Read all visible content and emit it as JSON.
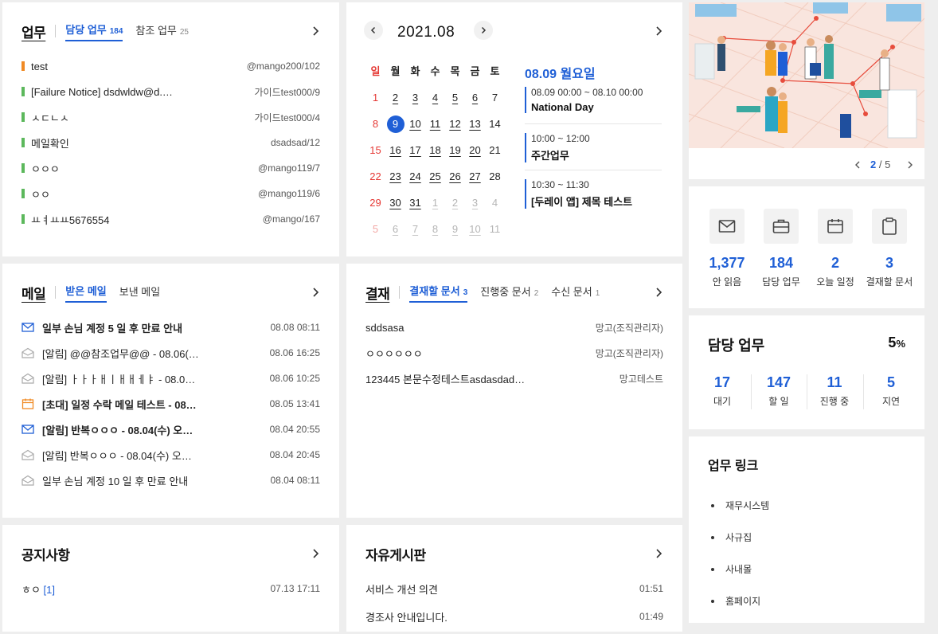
{
  "tasks": {
    "title": "업무",
    "tabs": [
      {
        "label": "담당 업무",
        "count": "184"
      },
      {
        "label": "참조 업무",
        "count": "25"
      }
    ],
    "items": [
      {
        "title": "test",
        "meta": "@mango200/102",
        "color": "#f08a24"
      },
      {
        "title": "[Failure Notice] dsdwldw@d.…",
        "meta": "가이드test000/9",
        "color": "#5cb85c"
      },
      {
        "title": "ㅅㄷㄴㅅ",
        "meta": "가이드test000/4",
        "color": "#5cb85c"
      },
      {
        "title": "메일확인",
        "meta": "dsadsad/12",
        "color": "#5cb85c"
      },
      {
        "title": "ㅇㅇㅇ",
        "meta": "@mango119/7",
        "color": "#5cb85c"
      },
      {
        "title": "ㅇㅇ",
        "meta": "@mango119/6",
        "color": "#5cb85c"
      },
      {
        "title": "ㅛㅕㅛㅛ5676554",
        "meta": "@mango/167",
        "color": "#5cb85c"
      }
    ]
  },
  "calendar": {
    "month": "2021.08",
    "weekdays": [
      "일",
      "월",
      "화",
      "수",
      "목",
      "금",
      "토"
    ],
    "weeks": [
      [
        "1",
        "2",
        "3",
        "4",
        "5",
        "6",
        "7"
      ],
      [
        "8",
        "9",
        "10",
        "11",
        "12",
        "13",
        "14"
      ],
      [
        "15",
        "16",
        "17",
        "18",
        "19",
        "20",
        "21"
      ],
      [
        "22",
        "23",
        "24",
        "25",
        "26",
        "27",
        "28"
      ],
      [
        "29",
        "30",
        "31",
        "1",
        "2",
        "3",
        "4"
      ],
      [
        "5",
        "6",
        "7",
        "8",
        "9",
        "10",
        "11"
      ]
    ],
    "selected_day": "08.09 월요일",
    "events": [
      {
        "time": "08.09 00:00 ~ 08.10 00:00",
        "name": "National Day"
      },
      {
        "time": "10:00 ~ 12:00",
        "name": "주간업무"
      },
      {
        "time": "10:30 ~ 11:30",
        "name": "[두레이 앱] 제목 테스트"
      }
    ]
  },
  "banner": {
    "page": "2",
    "total": "5"
  },
  "stats": [
    {
      "icon": "envelope-icon",
      "value": "1,377",
      "label": "안 읽음"
    },
    {
      "icon": "briefcase-icon",
      "value": "184",
      "label": "담당 업무"
    },
    {
      "icon": "calendar-icon",
      "value": "2",
      "label": "오늘 일정"
    },
    {
      "icon": "clipboard-icon",
      "value": "3",
      "label": "결재할 문서"
    }
  ],
  "my_tasks": {
    "title": "담당 업무",
    "percent": "5",
    "percent_unit": "%",
    "cells": [
      {
        "value": "17",
        "label": "대기"
      },
      {
        "value": "147",
        "label": "할 일"
      },
      {
        "value": "11",
        "label": "진행 중"
      },
      {
        "value": "5",
        "label": "지연"
      }
    ]
  },
  "mail": {
    "title": "메일",
    "tabs": [
      "받은 메일",
      "보낸 메일"
    ],
    "items": [
      {
        "subject": "일부 손님 계정 5 일 후 만료 안내",
        "date": "08.08 08:11",
        "unread": true,
        "icon": "mail-unread-icon"
      },
      {
        "subject": "[알림] @@참조업무@@ - 08.06(…",
        "date": "08.06 16:25",
        "unread": false,
        "icon": "mail-read-icon"
      },
      {
        "subject": "[알림] ㅏㅏㅏㅐㅣㅐㅐㅔㅑ - 08.0…",
        "date": "08.06 10:25",
        "unread": false,
        "icon": "mail-read-icon"
      },
      {
        "subject": "[초대] 일정 수락 메일 테스트 - 08…",
        "date": "08.05 13:41",
        "unread": true,
        "icon": "calendar-invite-icon"
      },
      {
        "subject": "[알림] 반복ㅇㅇㅇ - 08.04(수) 오…",
        "date": "08.04 20:55",
        "unread": true,
        "icon": "mail-unread-icon"
      },
      {
        "subject": "[알림] 반복ㅇㅇㅇ - 08.04(수) 오…",
        "date": "08.04 20:45",
        "unread": false,
        "icon": "mail-read-icon"
      },
      {
        "subject": "일부 손님 계정 10 일 후 만료 안내",
        "date": "08.04 08:11",
        "unread": false,
        "icon": "mail-read-icon"
      }
    ]
  },
  "approval": {
    "title": "결재",
    "tabs": [
      {
        "label": "결재할 문서",
        "count": "3"
      },
      {
        "label": "진행중 문서",
        "count": "2"
      },
      {
        "label": "수신 문서",
        "count": "1"
      }
    ],
    "items": [
      {
        "title": "sddsasa",
        "author": "망고(조직관리자)"
      },
      {
        "title": "ㅇㅇㅇㅇㅇㅇ",
        "author": "망고(조직관리자)"
      },
      {
        "title": "123445 본문수정테스트asdasdad…",
        "author": "망고테스트"
      }
    ]
  },
  "notice": {
    "title": "공지사항",
    "items": [
      {
        "title": "ㅎㅇ",
        "comments": "[1]",
        "date": "07.13 17:11"
      }
    ]
  },
  "board": {
    "title": "자유게시판",
    "items": [
      {
        "title": "서비스 개선 의견",
        "date": "01:51"
      },
      {
        "title": "경조사 안내입니다.",
        "date": "01:49"
      }
    ]
  },
  "links": {
    "title": "업무 링크",
    "items": [
      "재무시스템",
      "사규집",
      "사내몰",
      "홈페이지"
    ]
  }
}
